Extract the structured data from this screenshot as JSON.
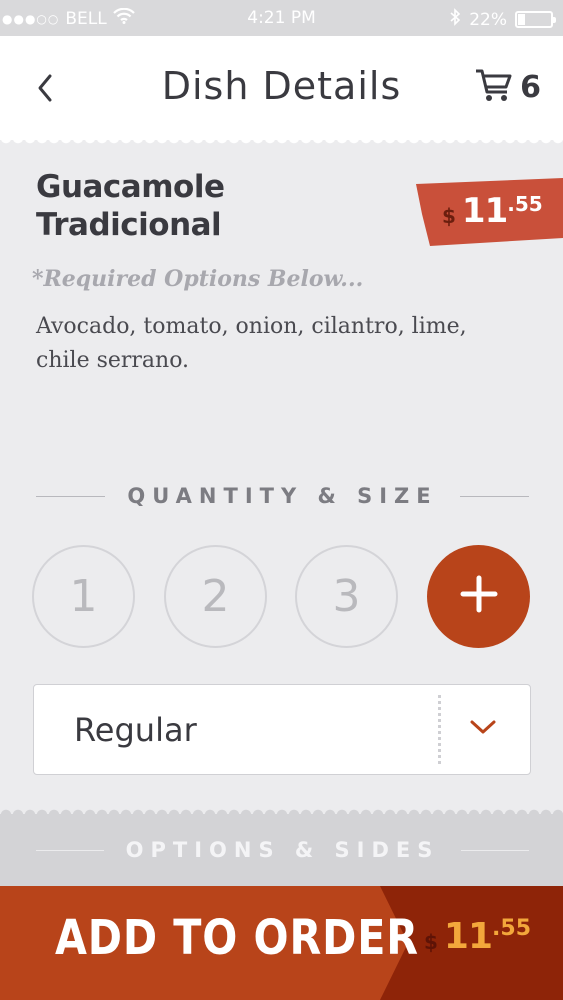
{
  "status_bar": {
    "signal_dots": "●●●○○",
    "carrier": "BELL",
    "wifi_icon": "wifi-icon",
    "time": "4:21 PM",
    "bluetooth_icon": "bluetooth-icon",
    "battery_percent": "22%",
    "battery_level": 0.22
  },
  "nav": {
    "back_icon": "chevron-left-icon",
    "title": "Dish Details",
    "cart_icon": "cart-icon",
    "cart_count": "6"
  },
  "dish": {
    "name_line1": "Guacamole",
    "name_line2": "Tradicional",
    "price_currency": "$",
    "price_dollars": "11",
    "price_cents": ".55",
    "required_note": "*Required Options Below...",
    "description": "Avocado, tomato, onion, cilantro, lime, chile serrano."
  },
  "quantity": {
    "heading": "QUANTITY & SIZE",
    "options": [
      "1",
      "2",
      "3"
    ],
    "more_icon": "plus-icon"
  },
  "size": {
    "selected": "Regular",
    "dropdown_icon": "chevron-down-icon"
  },
  "options_sides": {
    "heading": "OPTIONS & SIDES"
  },
  "order": {
    "label": "ADD TO ORDER",
    "currency": "$",
    "dollars": "11",
    "cents": ".55"
  },
  "colors": {
    "accent": "#b8441a",
    "price_tag": "#c9503a",
    "dark_price_panel": "#8e2408",
    "price_highlight": "#f3a73b"
  }
}
